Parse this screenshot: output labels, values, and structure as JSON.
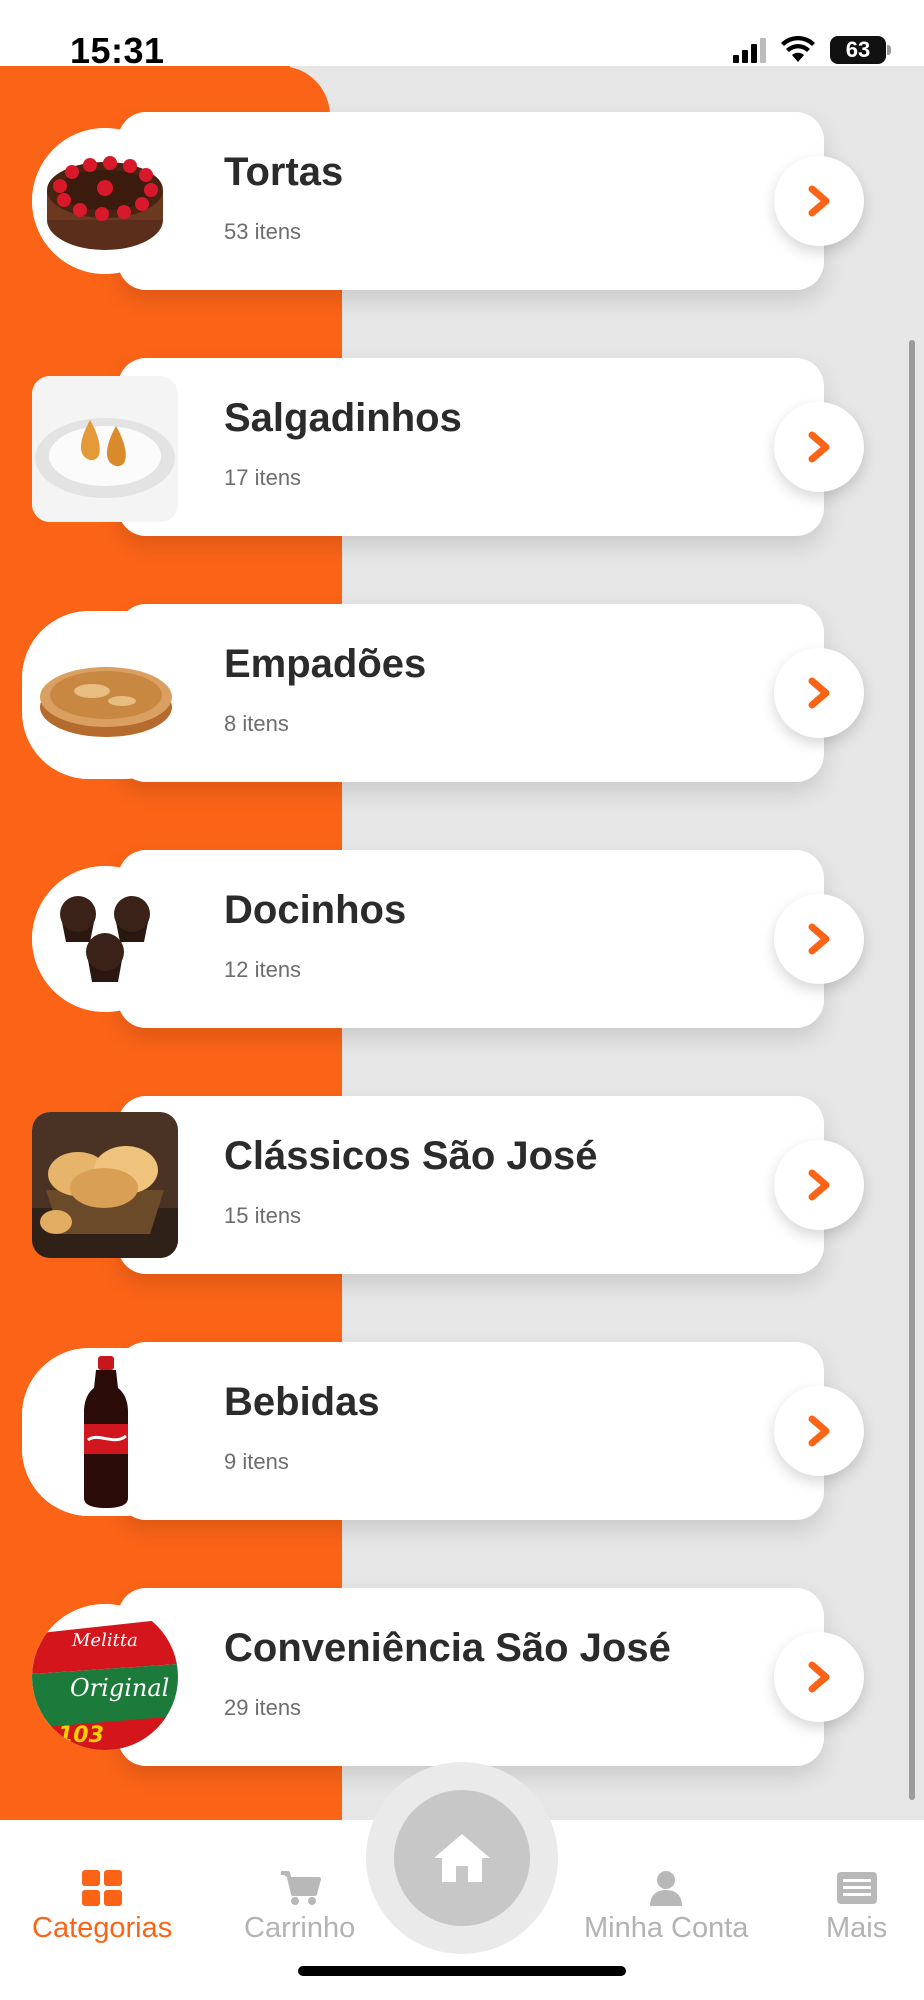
{
  "status_bar": {
    "time": "15:31",
    "battery": "63"
  },
  "colors": {
    "accent": "#fb6417",
    "inactive": "#b3b3b3",
    "card_text": "#2b2b2b"
  },
  "categories": [
    {
      "name": "Tortas",
      "count": "53 itens",
      "thumb": "chocolate-strawberry-cake"
    },
    {
      "name": "Salgadinhos",
      "count": "17 itens",
      "thumb": "coxinha-plate"
    },
    {
      "name": "Empadões",
      "count": "8 itens",
      "thumb": "empadao-pie"
    },
    {
      "name": "Docinhos",
      "count": "12 itens",
      "thumb": "brigadeiros"
    },
    {
      "name": "Clássicos São José",
      "count": "15 itens",
      "thumb": "bread-basket"
    },
    {
      "name": "Bebidas",
      "count": "9 itens",
      "thumb": "cola-bottle"
    },
    {
      "name": "Conveniência São José",
      "count": "29 itens",
      "thumb": "coffee-filter-box",
      "brand": "Melitta",
      "product": "Original",
      "number": "103"
    }
  ],
  "bottom_nav": {
    "items": [
      {
        "label": "Categorias",
        "icon": "grid-icon",
        "active": true
      },
      {
        "label": "Carrinho",
        "icon": "cart-icon",
        "active": false
      },
      {
        "label": "Minha Conta",
        "icon": "user-icon",
        "active": false
      },
      {
        "label": "Mais",
        "icon": "list-card-icon",
        "active": false
      }
    ],
    "home_icon": "home-icon"
  }
}
